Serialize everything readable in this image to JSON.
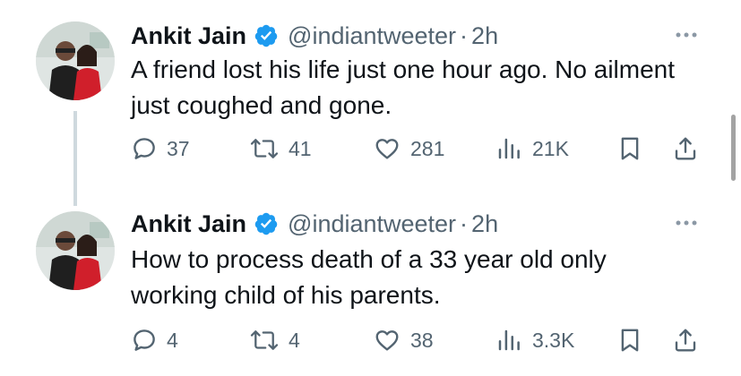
{
  "tweets": [
    {
      "author_name": "Ankit Jain",
      "handle": "@indiantweeter",
      "separator": "·",
      "time": "2h",
      "text": "A friend lost his life just one hour ago. No ailment just coughed and gone.",
      "stats": {
        "replies": "37",
        "retweets": "41",
        "likes": "281",
        "views": "21K"
      }
    },
    {
      "author_name": "Ankit Jain",
      "handle": "@indiantweeter",
      "separator": "·",
      "time": "2h",
      "text": "How to process death of a 33 year old only working child of his parents.",
      "stats": {
        "replies": "4",
        "retweets": "4",
        "likes": "38",
        "views": "3.3K"
      }
    }
  ],
  "colors": {
    "text_primary": "#0f1419",
    "text_secondary": "#536471",
    "verified": "#1d9bf0",
    "thread_line": "#cfd9de"
  },
  "icons": {
    "verified": "verified-badge-icon",
    "more": "more-dots-icon",
    "reply": "reply-bubble-icon",
    "retweet": "retweet-icon",
    "like": "heart-icon",
    "views": "analytics-bars-icon",
    "bookmark": "bookmark-icon",
    "share": "share-upload-icon"
  }
}
